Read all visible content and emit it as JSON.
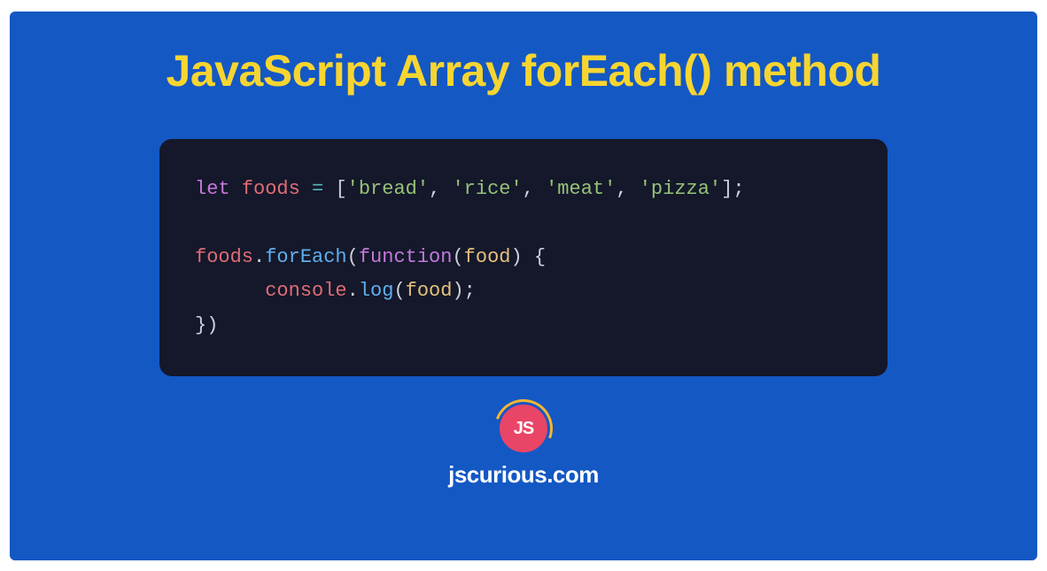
{
  "title": "JavaScript Array forEach() method",
  "code": {
    "line1": {
      "let": "let",
      "var": "foods",
      "eq": "=",
      "lb": "[",
      "s1": "'bread'",
      "c1": ",",
      "s2": "'rice'",
      "c2": ",",
      "s3": "'meat'",
      "c3": ",",
      "s4": "'pizza'",
      "rb": "];"
    },
    "line3": {
      "obj": "foods",
      "dot": ".",
      "method": "forEach",
      "lp": "(",
      "func": "function",
      "lp2": "(",
      "param": "food",
      "rp2": ")",
      "brace": "{"
    },
    "line4": {
      "indent": "      ",
      "console": "console",
      "dot": ".",
      "log": "log",
      "lp": "(",
      "param": "food",
      "rp": ");"
    },
    "line5": {
      "close": "})"
    }
  },
  "logo": {
    "text": "JS"
  },
  "site": "jscurious.com"
}
